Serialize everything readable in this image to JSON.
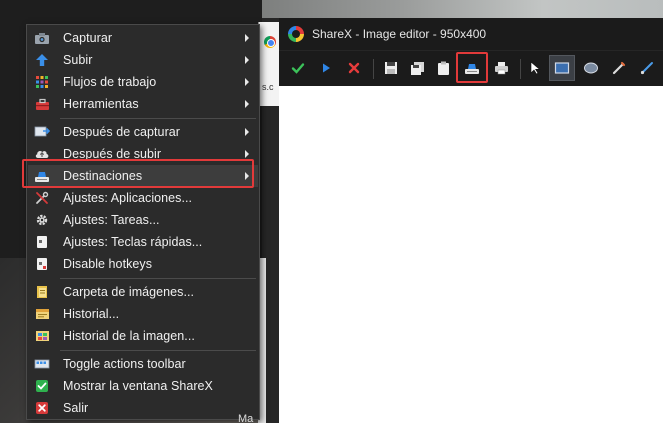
{
  "editor": {
    "title": "ShareX - Image editor - 950x400",
    "toolbar": [
      {
        "icon": "checkmark-icon",
        "name": "confirm-button"
      },
      {
        "icon": "play-icon",
        "name": "continue-button"
      },
      {
        "icon": "close-x-icon",
        "name": "cancel-button"
      },
      {
        "icon": "save-icon",
        "name": "save-button"
      },
      {
        "icon": "save-as-icon",
        "name": "save-as-button"
      },
      {
        "icon": "clipboard-icon",
        "name": "copy-button"
      },
      {
        "icon": "upload-icon",
        "name": "upload-button"
      },
      {
        "icon": "print-icon",
        "name": "print-button"
      },
      {
        "icon": "cursor-icon",
        "name": "select-tool"
      },
      {
        "icon": "rectangle-icon",
        "name": "rectangle-tool"
      },
      {
        "icon": "ellipse-icon",
        "name": "ellipse-tool"
      },
      {
        "icon": "pen-icon",
        "name": "freehand-tool"
      },
      {
        "icon": "line-icon",
        "name": "line-tool"
      }
    ],
    "highlighted_button": "upload-button",
    "active_tool": "rectangle-tool"
  },
  "menu": {
    "items": [
      {
        "label": "Capturar",
        "icon": "camera-icon",
        "submenu": true
      },
      {
        "label": "Subir",
        "icon": "upload-arrow-icon",
        "submenu": true
      },
      {
        "label": "Flujos de trabajo",
        "icon": "workflows-grid-icon",
        "submenu": true
      },
      {
        "label": "Herramientas",
        "icon": "toolbox-icon",
        "submenu": true
      },
      {
        "label": "Después de capturar",
        "icon": "after-capture-icon",
        "submenu": true
      },
      {
        "label": "Después de subir",
        "icon": "cloud-icon",
        "submenu": true
      },
      {
        "label": "Destinaciones",
        "icon": "destinations-icon",
        "submenu": true
      },
      {
        "label": "Ajustes: Aplicaciones...",
        "icon": "app-settings-icon",
        "submenu": false
      },
      {
        "label": "Ajustes: Tareas...",
        "icon": "gear-icon",
        "submenu": false
      },
      {
        "label": "Ajustes: Teclas rápidas...",
        "icon": "keyboard-icon",
        "submenu": false
      },
      {
        "label": "Disable hotkeys",
        "icon": "keyboard-disable-icon",
        "submenu": false
      },
      {
        "label": "Carpeta de imágenes...",
        "icon": "folder-icon",
        "submenu": false
      },
      {
        "label": "Historial...",
        "icon": "history-icon",
        "submenu": false
      },
      {
        "label": "Historial de la imagen...",
        "icon": "image-history-icon",
        "submenu": false
      },
      {
        "label": "Toggle actions toolbar",
        "icon": "toolbar-icon",
        "submenu": false
      },
      {
        "label": "Mostrar la ventana ShareX",
        "icon": "green-check-icon",
        "submenu": false
      },
      {
        "label": "Salir",
        "icon": "red-x-icon",
        "submenu": false
      }
    ],
    "highlighted_item": "Destinaciones"
  },
  "background": {
    "sliver_text": "s.c",
    "truncated_label": "Ma"
  },
  "colors": {
    "menu_bg": "#2b2b2b",
    "highlight_border": "#e23a3a",
    "editor_titlebar": "#1b1b1b"
  }
}
